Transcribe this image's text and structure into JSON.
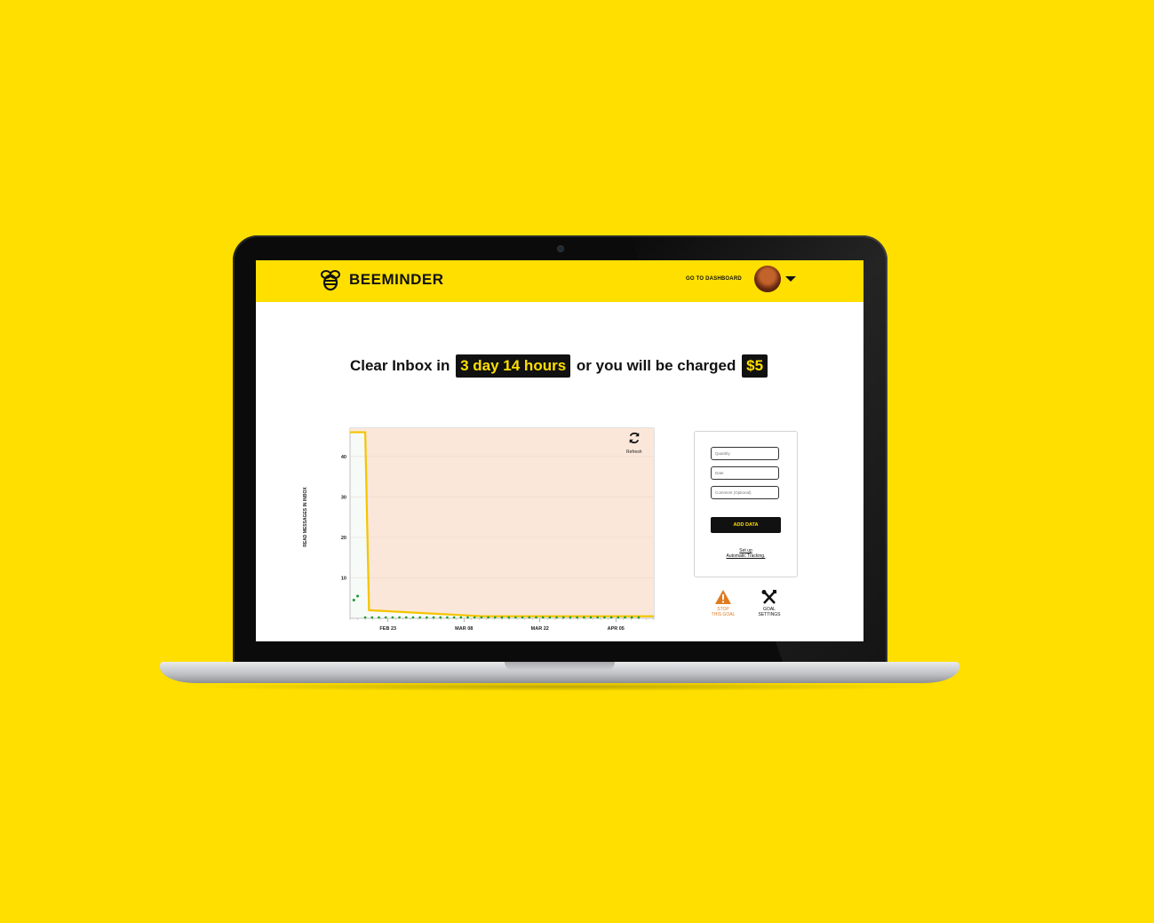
{
  "nav": {
    "brand": "BEEMINDER",
    "dashboard_link": "GO TO DASHBOARD"
  },
  "headline": {
    "prefix": "Clear Inbox in",
    "time_left": "3 day 14 hours",
    "middle": "or you will be charged",
    "amount": "$5"
  },
  "chart": {
    "refresh_label": "Refresh"
  },
  "chart_data": {
    "type": "line",
    "ylabel": "READ MESSAGES IN INBOX",
    "yticks": [
      10,
      20,
      30,
      40
    ],
    "xticks": [
      "FEB 23",
      "MAR 08",
      "MAR 22",
      "APR 05"
    ],
    "ylim": [
      0,
      47
    ],
    "grid": true,
    "road": [
      [
        0,
        46
      ],
      [
        4,
        46
      ],
      [
        5,
        2
      ],
      [
        35,
        0.5
      ],
      [
        80,
        0.5
      ]
    ],
    "points_early": [
      [
        1,
        4.5
      ],
      [
        2,
        5.5
      ]
    ],
    "points_flat": {
      "y": 0,
      "count": 41,
      "x_start": 4,
      "x_step": 1.8
    }
  },
  "data_entry": {
    "quantity_placeholder": "Quantity",
    "date_placeholder": "Date",
    "comment_placeholder": "Comment (Optional)",
    "add_button": "ADD DATA",
    "auto_tracking_line1": "Set up",
    "auto_tracking_line2": "Automatic Tracking."
  },
  "actions": {
    "stop_line1": "STOP",
    "stop_line2": "THIS GOAL",
    "settings_line1": "GOAL",
    "settings_line2": "SETTINGS"
  },
  "colors": {
    "brand_yellow": "#FFDF00",
    "road": "#F5C400",
    "region": "#FBE7D9",
    "points": "#1a9a2a",
    "warning": "#E07A1F"
  }
}
